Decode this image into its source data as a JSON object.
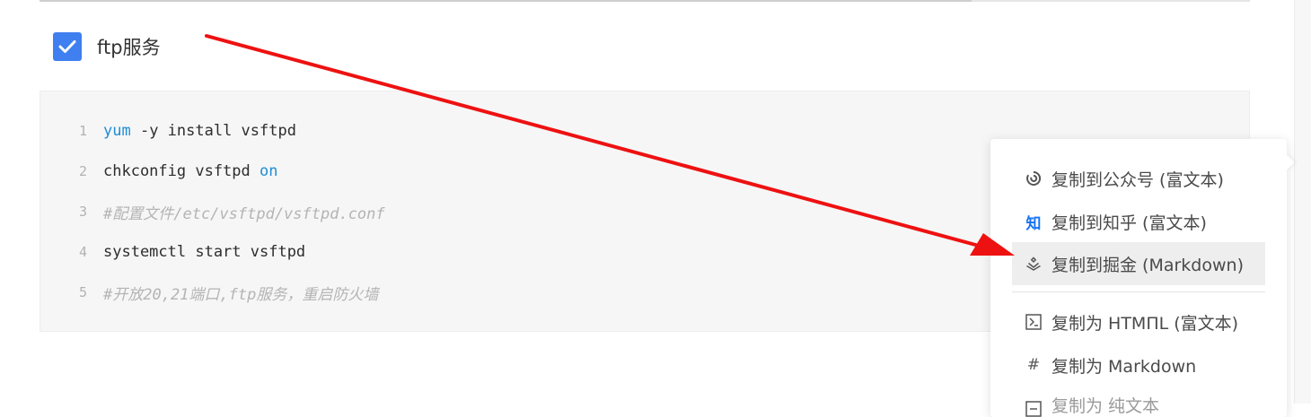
{
  "task_item": {
    "label": "ftp服务",
    "checked": true
  },
  "code_block": {
    "lines": [
      {
        "num": "1",
        "parts": [
          {
            "t": "yum",
            "k": "kw"
          },
          {
            "t": " -y install vsftpd",
            "k": "tx"
          }
        ]
      },
      {
        "num": "2",
        "parts": [
          {
            "t": "chkconfig vsftpd ",
            "k": "tx"
          },
          {
            "t": "on",
            "k": "kw"
          }
        ]
      },
      {
        "num": "3",
        "parts": [
          {
            "t": "#配置文件/etc/vsftpd/vsftpd.conf",
            "k": "cm"
          }
        ]
      },
      {
        "num": "4",
        "parts": [
          {
            "t": "systemctl start vsftpd",
            "k": "tx"
          }
        ]
      },
      {
        "num": "5",
        "parts": [
          {
            "t": "#开放20,21端口,ftp服务，重启防火墙",
            "k": "cm"
          }
        ]
      }
    ]
  },
  "copy_menu": {
    "items": [
      {
        "icon": "wechat-icon",
        "glyph": "",
        "label": "复制到公众号 (富文本)"
      },
      {
        "icon": "zhihu-icon",
        "glyph": "知",
        "label": "复制到知乎 (富文本)"
      },
      {
        "icon": "juejin-icon",
        "glyph": "",
        "label": "复制到掘金 (Markdown)",
        "highlighted": true
      },
      {
        "icon": "terminal-icon",
        "glyph": "",
        "label": "复制为 HTMΠL (富文本)"
      },
      {
        "icon": "hash-icon",
        "glyph": "#",
        "label": "复制为 Markdown"
      },
      {
        "icon": "text-icon",
        "glyph": "",
        "label": "复制为 纯文本"
      }
    ]
  },
  "colors": {
    "accent": "#3f7ff0",
    "keyword": "#1f8dd6",
    "annotation_arrow": "#ee1111",
    "zhihu_blue": "#1772f6"
  }
}
